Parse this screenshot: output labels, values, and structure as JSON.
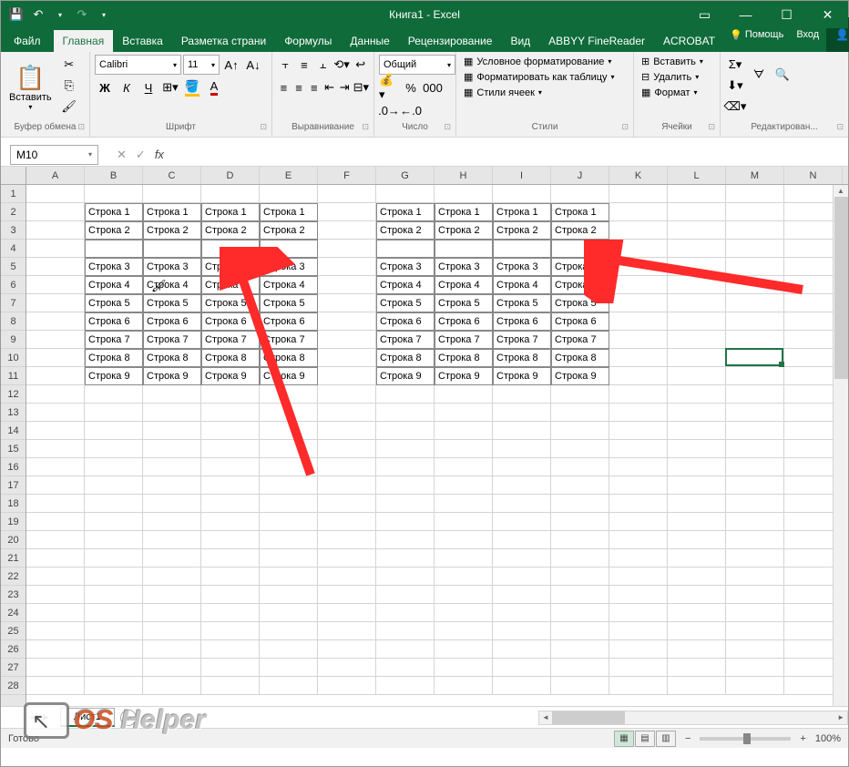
{
  "title": "Книга1 - Excel",
  "qat": {
    "save": "💾",
    "undo": "↶",
    "redo": "↷"
  },
  "win": {
    "min": "—",
    "max": "☐",
    "close": "✕",
    "ribbon_opts": "▭"
  },
  "tabs": {
    "file": "Файл",
    "home": "Главная",
    "insert": "Вставка",
    "layout": "Разметка страни",
    "formulas": "Формулы",
    "data": "Данные",
    "review": "Рецензирование",
    "view": "Вид",
    "abbyy": "ABBYY FineReader",
    "acrobat": "ACROBAT"
  },
  "help": {
    "tell": "Помощь",
    "signin": "Вход",
    "share": "Общий доступ"
  },
  "ribbon": {
    "clipboard": {
      "paste": "Вставить",
      "label": "Буфер обмена"
    },
    "font": {
      "name": "Calibri",
      "size": "11",
      "bold": "Ж",
      "italic": "К",
      "underline": "Ч",
      "label": "Шрифт"
    },
    "align": {
      "label": "Выравнивание"
    },
    "number": {
      "format": "Общий",
      "label": "Число"
    },
    "styles": {
      "cond": "Условное форматирование",
      "table": "Форматировать как таблицу",
      "cell": "Стили ячеек",
      "label": "Стили"
    },
    "cells": {
      "insert": "Вставить",
      "delete": "Удалить",
      "format": "Формат",
      "label": "Ячейки"
    },
    "editing": {
      "label": "Редактирован..."
    }
  },
  "namebox": "M10",
  "columns": [
    "A",
    "B",
    "C",
    "D",
    "E",
    "F",
    "G",
    "H",
    "I",
    "J",
    "K",
    "L",
    "M",
    "N"
  ],
  "rows": 28,
  "cell_text_prefix": "Строка ",
  "data_rows": [
    {
      "r": 2,
      "n": 1
    },
    {
      "r": 3,
      "n": 2
    },
    {
      "r": 4,
      "n": null
    },
    {
      "r": 5,
      "n": 3
    },
    {
      "r": 6,
      "n": 4
    },
    {
      "r": 7,
      "n": 5
    },
    {
      "r": 8,
      "n": 6
    },
    {
      "r": 9,
      "n": 7
    },
    {
      "r": 10,
      "n": 8
    },
    {
      "r": 11,
      "n": 9
    }
  ],
  "data_cols_left": [
    "B",
    "C",
    "D",
    "E"
  ],
  "data_cols_right": [
    "G",
    "H",
    "I",
    "J"
  ],
  "active_cell": {
    "col": 12,
    "row": 10
  },
  "sheet": {
    "name": "Лист1"
  },
  "status": {
    "ready": "Готово",
    "zoom": "100%"
  }
}
